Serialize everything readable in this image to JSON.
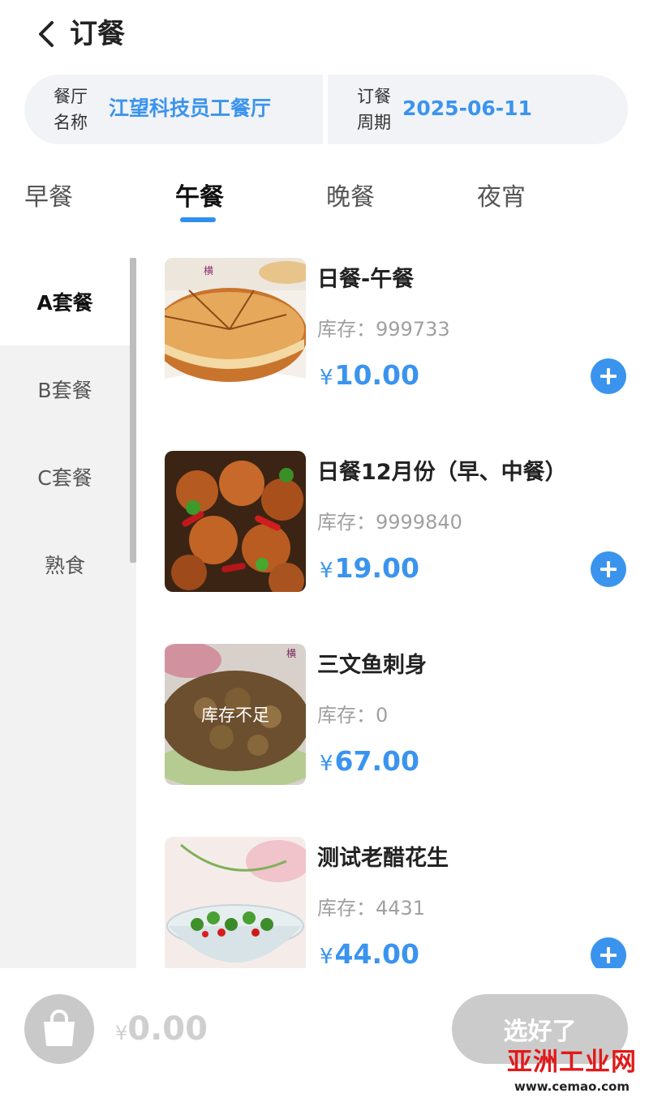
{
  "header": {
    "title": "订餐"
  },
  "info": {
    "restaurant_label_line1": "餐厅",
    "restaurant_label_line2": "名称",
    "restaurant_name": "江望科技员工餐厅",
    "period_label_line1": "订餐",
    "period_label_line2": "周期",
    "period_value": "2025-06-11"
  },
  "tabs": [
    {
      "label": "早餐"
    },
    {
      "label": "午餐"
    },
    {
      "label": "晚餐"
    },
    {
      "label": "夜宵"
    }
  ],
  "active_tab": "午餐",
  "categories": [
    {
      "label": "A套餐"
    },
    {
      "label": "B套餐"
    },
    {
      "label": "C套餐"
    },
    {
      "label": "熟食"
    }
  ],
  "active_category": "A套餐",
  "products": [
    {
      "name": "日餐-午餐",
      "stock": "库存：999733",
      "currency": "¥",
      "price": "10.00",
      "image": "pancake-dish"
    },
    {
      "name": "日餐12月份（早、中餐）",
      "stock": "库存：9999840",
      "currency": "¥",
      "price": "19.00",
      "image": "spicy-chicken-dish"
    },
    {
      "name": "三文鱼刺身",
      "stock": "库存：0",
      "currency": "¥",
      "price": "67.00",
      "image": "nut-brittle-dish",
      "badge": "库存不足"
    },
    {
      "name": "测试老醋花生",
      "stock": "库存：4431",
      "currency": "¥",
      "price": "44.00",
      "image": "pepper-bowl-dish"
    }
  ],
  "cart": {
    "currency": "¥",
    "total": "0.00",
    "icon": "shopping-bag-icon"
  },
  "submit_label": "选好了",
  "watermark": {
    "main": "亚洲工业网",
    "sub": "www.cemao.com"
  },
  "colors": {
    "accent": "#3a94ee",
    "tab_underline": "#2f8ff0",
    "sidebar_bg": "#f2f2f2",
    "disabled": "#cbcbcb",
    "watermark_red": "#e11a1a"
  }
}
